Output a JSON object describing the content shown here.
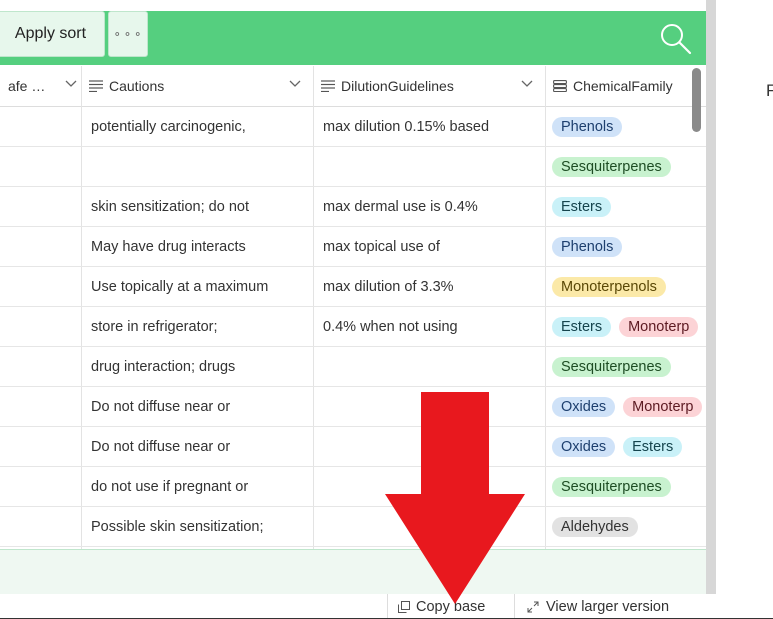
{
  "toolbar": {
    "apply_sort_label": "Apply sort",
    "more_label": "⚬⚬⚬"
  },
  "columns": [
    {
      "key": "safe",
      "label": "afe …"
    },
    {
      "key": "cautions",
      "label": "Cautions"
    },
    {
      "key": "dilution",
      "label": "DilutionGuidelines"
    },
    {
      "key": "chemfamily",
      "label": "ChemicalFamily"
    }
  ],
  "rows": [
    {
      "cautions": "potentially carcinogenic,",
      "dilution": "max dilution 0.15% based",
      "tags": [
        "Phenols"
      ]
    },
    {
      "cautions": "",
      "dilution": "",
      "tags": [
        "Sesquiterpenes"
      ]
    },
    {
      "cautions": "skin sensitization; do not",
      "dilution": "max dermal use is 0.4%",
      "tags": [
        "Esters"
      ]
    },
    {
      "cautions": "May have drug interacts",
      "dilution": "max topical  use  of",
      "tags": [
        "Phenols"
      ]
    },
    {
      "cautions": "Use topically at a maximum",
      "dilution": "max dilution of 3.3%",
      "tags": [
        "Monoterpenols"
      ]
    },
    {
      "cautions": "store in refrigerator;",
      "dilution": "0.4% when not using",
      "tags": [
        "Esters",
        "Monoterp"
      ]
    },
    {
      "cautions": "drug interaction; drugs",
      "dilution": "",
      "tags": [
        "Sesquiterpenes"
      ]
    },
    {
      "cautions": "Do not diffuse near or",
      "dilution": "",
      "tags": [
        "Oxides",
        "Monoterp"
      ]
    },
    {
      "cautions": "Do not diffuse near or",
      "dilution": "",
      "tags": [
        "Oxides",
        "Esters"
      ]
    },
    {
      "cautions": "do not use if pregnant or",
      "dilution": "",
      "tags": [
        "Sesquiterpenes"
      ]
    },
    {
      "cautions": "Possible skin sensitization;",
      "dilution": "",
      "tags": [
        "Aldehydes"
      ]
    }
  ],
  "tag_colors": {
    "Phenols": {
      "bg": "#cfe2f8",
      "fg": "#1d3f6e"
    },
    "Sesquiterpenes": {
      "bg": "#c8f2cf",
      "fg": "#1e4d24"
    },
    "Esters": {
      "bg": "#c9f1f8",
      "fg": "#15444d"
    },
    "Monoterpenols": {
      "bg": "#fbe9a8",
      "fg": "#5a4806"
    },
    "Monoterp": {
      "bg": "#fcd3d6",
      "fg": "#5d1a22"
    },
    "Oxides": {
      "bg": "#cfe2f8",
      "fg": "#1d3f6e"
    },
    "Aldehydes": {
      "bg": "#e2e2e2",
      "fg": "#333333"
    }
  },
  "footer": {
    "copy_base_label": "Copy base",
    "view_larger_label": "View larger version"
  },
  "stray_text": "F",
  "colors": {
    "toolbar": "#55cf7f",
    "arrow": "#e8181e"
  }
}
